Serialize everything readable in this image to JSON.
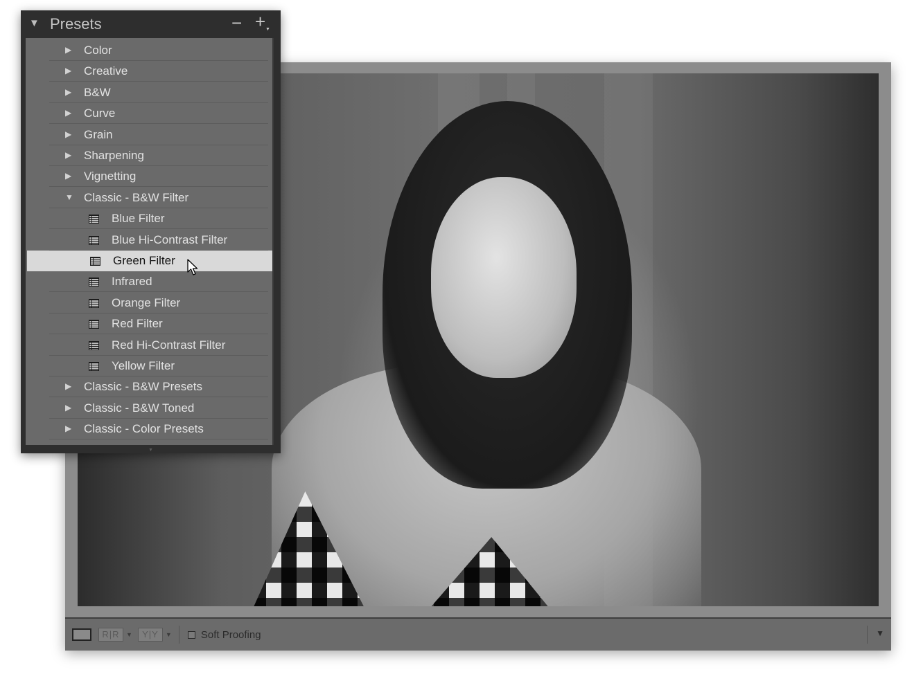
{
  "presets_panel": {
    "title": "Presets",
    "collapse_icon": "triangle-down-icon",
    "remove_icon": "minus-icon",
    "add_icon": "plus-icon",
    "items": [
      {
        "label": "Color",
        "type": "folder",
        "expanded": false
      },
      {
        "label": "Creative",
        "type": "folder",
        "expanded": false
      },
      {
        "label": "B&W",
        "type": "folder",
        "expanded": false
      },
      {
        "label": "Curve",
        "type": "folder",
        "expanded": false
      },
      {
        "label": "Grain",
        "type": "folder",
        "expanded": false
      },
      {
        "label": "Sharpening",
        "type": "folder",
        "expanded": false
      },
      {
        "label": "Vignetting",
        "type": "folder",
        "expanded": false
      },
      {
        "label": "Classic - B&W Filter",
        "type": "folder",
        "expanded": true
      },
      {
        "label": "Blue Filter",
        "type": "preset"
      },
      {
        "label": "Blue Hi-Contrast Filter",
        "type": "preset"
      },
      {
        "label": "Green Filter",
        "type": "preset",
        "selected": true
      },
      {
        "label": "Infrared",
        "type": "preset"
      },
      {
        "label": "Orange Filter",
        "type": "preset"
      },
      {
        "label": "Red Filter",
        "type": "preset"
      },
      {
        "label": "Red Hi-Contrast Filter",
        "type": "preset"
      },
      {
        "label": "Yellow Filter",
        "type": "preset"
      },
      {
        "label": "Classic - B&W Presets",
        "type": "folder",
        "expanded": false
      },
      {
        "label": "Classic - B&W Toned",
        "type": "folder",
        "expanded": false
      },
      {
        "label": "Classic - Color Presets",
        "type": "folder",
        "expanded": false
      }
    ]
  },
  "toolbar": {
    "compare_rr_label": "R|R",
    "compare_yy_label": "Y|Y",
    "soft_proofing_label": "Soft Proofing",
    "soft_proofing_checked": false
  },
  "colors": {
    "panel_bg": "#6a6a6a",
    "panel_header_bg": "#2e2e2e",
    "selected_row_bg": "#d9d9d9"
  }
}
